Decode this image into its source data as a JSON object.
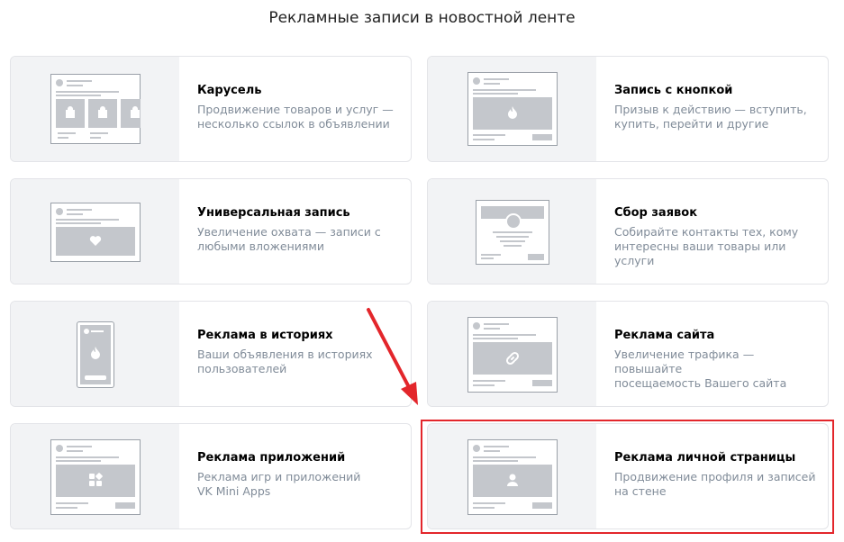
{
  "page": {
    "title": "Рекламные записи в новостной ленте"
  },
  "cards": [
    {
      "title": "Карусель",
      "desc_line1": "Продвижение товаров и услуг —",
      "desc_line2": "несколько ссылок в объявлении"
    },
    {
      "title": "Запись с кнопкой",
      "desc_line1": "Призыв к действию — вступить,",
      "desc_line2": "купить, перейти и другие"
    },
    {
      "title": "Универсальная запись",
      "desc_line1": "Увеличение охвата — записи с",
      "desc_line2": "любыми вложениями"
    },
    {
      "title": "Сбор заявок",
      "desc_line1": "Собирайте контакты тех, кому",
      "desc_line2": "интересны ваши товары или услуги"
    },
    {
      "title": "Реклама в историях",
      "desc_line1": "Ваши объявления в историях",
      "desc_line2": "пользователей"
    },
    {
      "title": "Реклама сайта",
      "desc_line1": "Увеличение трафика — повышайте",
      "desc_line2": "посещаемость Вашего сайта"
    },
    {
      "title": "Реклама приложений",
      "desc_line1": "Реклама игр и приложений",
      "desc_line2": "VK Mini Apps"
    },
    {
      "title": "Реклама личной страницы",
      "desc_line1": "Продвижение профиля и записей",
      "desc_line2": "на стене"
    }
  ],
  "icons": [
    "carousel-preview-icon",
    "button-post-preview-icon",
    "universal-post-preview-icon",
    "lead-form-preview-icon",
    "stories-preview-icon",
    "website-preview-icon",
    "apps-preview-icon",
    "personal-page-preview-icon"
  ],
  "colors": {
    "highlight": "#e3262b",
    "arrow": "#e3262b",
    "thumb_bg": "#f2f3f5",
    "wireframe": "#c4c7cc"
  }
}
